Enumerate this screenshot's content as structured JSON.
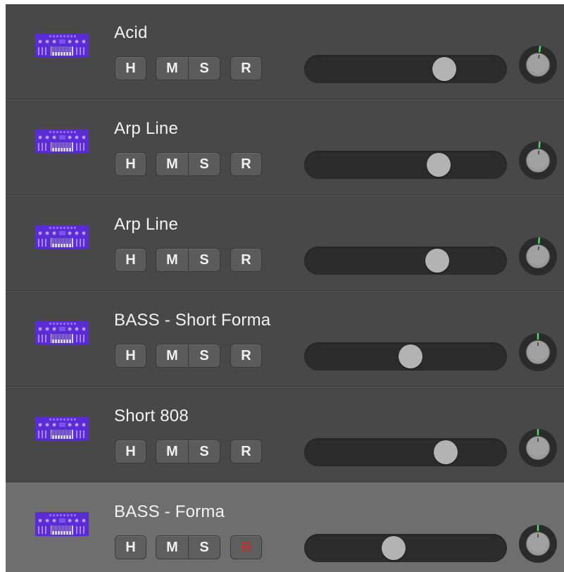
{
  "colors": {
    "row_background": "#484848",
    "row_selected_background": "#6e6e6e",
    "icon_purple": "#5b2bd6",
    "button_face": "#5b5b5b",
    "button_text": "#f0f0f0",
    "record_armed_text": "#c0332b",
    "slider_track": "#2c2c2c",
    "slider_thumb": "#b3b3b3",
    "knob_indicator": "#4cd964"
  },
  "buttons": {
    "hide_label": "H",
    "mute_label": "M",
    "solo_label": "S",
    "record_label": "R"
  },
  "tracks": [
    {
      "name": "Acid",
      "icon": "synth-keyboard-icon",
      "volume": 0.72,
      "pan": 0.05,
      "selected": false,
      "record_armed": false
    },
    {
      "name": "Arp Line",
      "icon": "synth-keyboard-icon",
      "volume": 0.69,
      "pan": 0.04,
      "selected": false,
      "record_armed": false
    },
    {
      "name": "Arp Line",
      "icon": "synth-keyboard-icon",
      "volume": 0.68,
      "pan": 0.03,
      "selected": false,
      "record_armed": false
    },
    {
      "name": "BASS - Short Forma",
      "icon": "synth-keyboard-icon",
      "volume": 0.53,
      "pan": 0.0,
      "selected": false,
      "record_armed": false
    },
    {
      "name": "Short 808",
      "icon": "synth-keyboard-icon",
      "volume": 0.73,
      "pan": 0.0,
      "selected": false,
      "record_armed": false
    },
    {
      "name": "BASS - Forma",
      "icon": "synth-keyboard-icon",
      "volume": 0.43,
      "pan": 0.0,
      "selected": true,
      "record_armed": true
    }
  ]
}
